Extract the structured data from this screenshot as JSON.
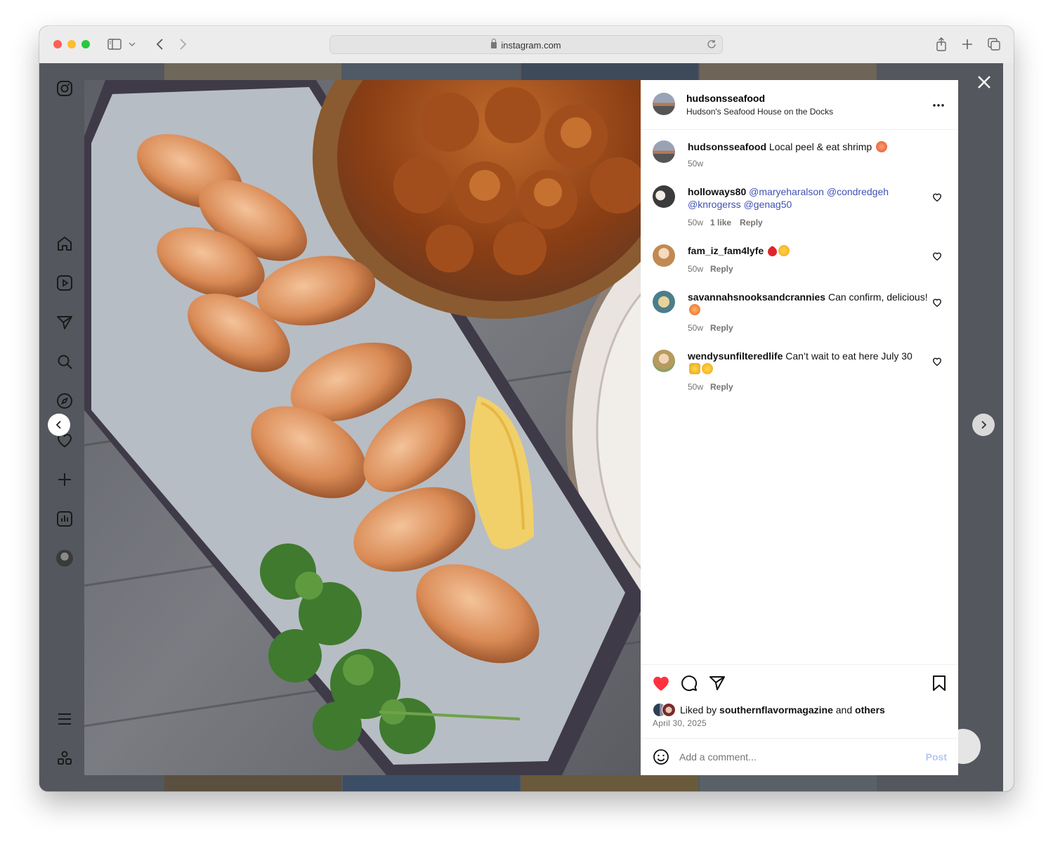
{
  "browser": {
    "url": "instagram.com"
  },
  "post": {
    "username": "hudsonsseafood",
    "location": "Hudson's Seafood House on the Docks",
    "caption_user": "hudsonsseafood",
    "caption_text": "Local peel & eat shrimp",
    "caption_time": "50w",
    "liked_by_prefix": "Liked by",
    "liked_by_user": "southernflavormagazine",
    "liked_by_and": "and",
    "liked_by_others": "others",
    "date": "April 30, 2025"
  },
  "comments": [
    {
      "user": "holloways80",
      "mentions": "@maryeharalson @condredgeh @knrogerss @genag50",
      "time": "50w",
      "likes": "1 like",
      "reply": "Reply"
    },
    {
      "user": "fam_iz_fam4lyfe",
      "text": "",
      "time": "50w",
      "reply": "Reply"
    },
    {
      "user": "savannahsnooksandcrannies",
      "text": "Can confirm, delicious!",
      "time": "50w",
      "reply": "Reply"
    },
    {
      "user": "wendysunfilteredlife",
      "text": "Can’t wait to eat here July 30",
      "time": "50w",
      "reply": "Reply"
    }
  ],
  "comment_box": {
    "placeholder": "Add a comment...",
    "post_label": "Post"
  },
  "colors": {
    "like_red": "#ff3040",
    "mention_blue": "#3f51b5",
    "post_button_disabled": "#b2c7f5"
  }
}
